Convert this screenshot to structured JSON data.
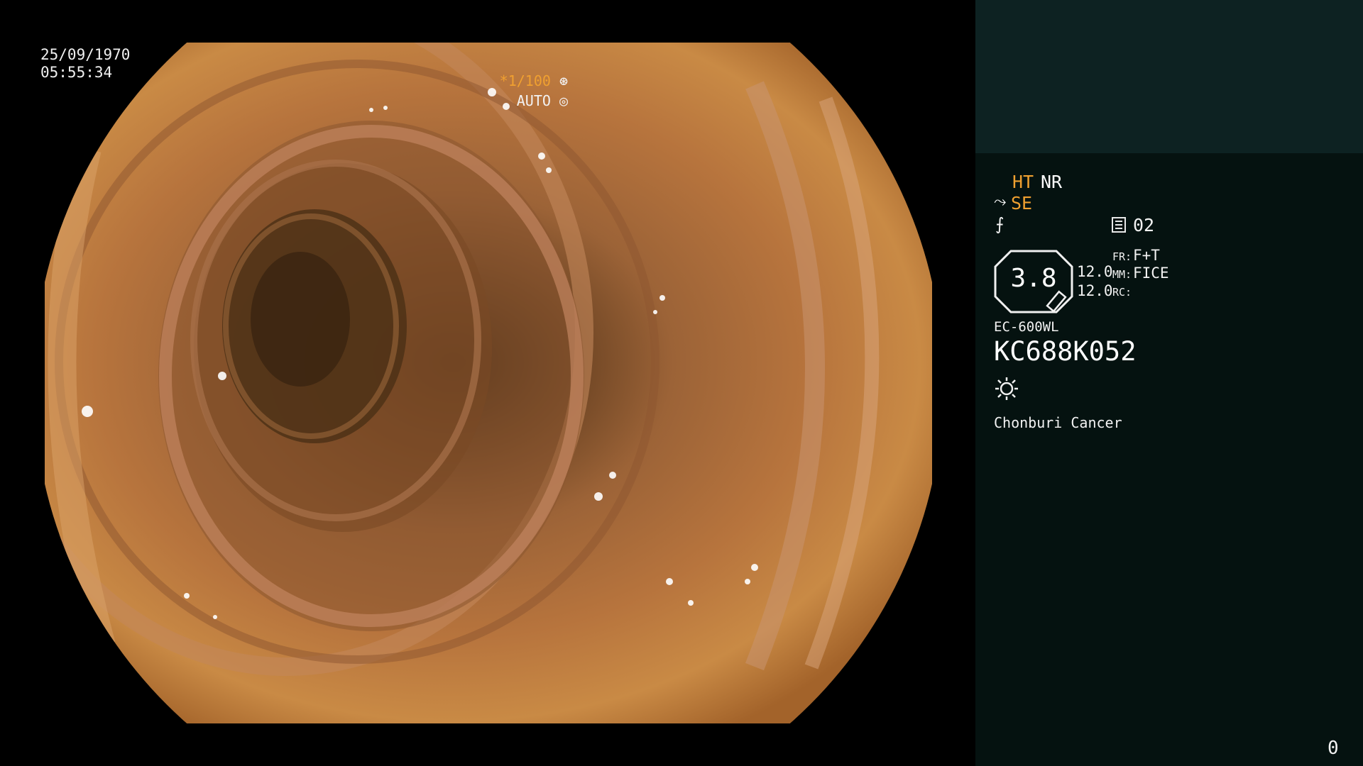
{
  "overlay": {
    "date": "25/09/1970",
    "time": "05:55:34",
    "shutter_speed": "*1/100",
    "exposure_mode": "AUTO"
  },
  "status_panel": {
    "ht_label": "HT",
    "nr_label": "NR",
    "se_label": "SE",
    "doc_number": "02",
    "octagon_value": "3.8",
    "value_1": "12.0",
    "value_2": "12.0",
    "fr_label": "FR:",
    "fr_value": "F+T",
    "mm_label": "MM:",
    "mm_value": "FICE",
    "rc_label": "RC:",
    "scope_model": "EC-600WL",
    "scope_serial": "KC688K052",
    "hospital_name": "Chonburi Cancer",
    "counter": "0"
  },
  "icons": {
    "shutter_icon": "aperture-icon",
    "auto_icon": "auto-exposure-icon",
    "se_icon": "structure-enhancement-icon",
    "f_icon": "color-tone-icon",
    "doc_icon": "document-icon",
    "light_icon": "light-source-icon"
  },
  "colors": {
    "accent_orange": "#f0a030",
    "panel_top": "#0d2222",
    "panel_bottom": "#051210",
    "tissue": "#b8743a"
  }
}
